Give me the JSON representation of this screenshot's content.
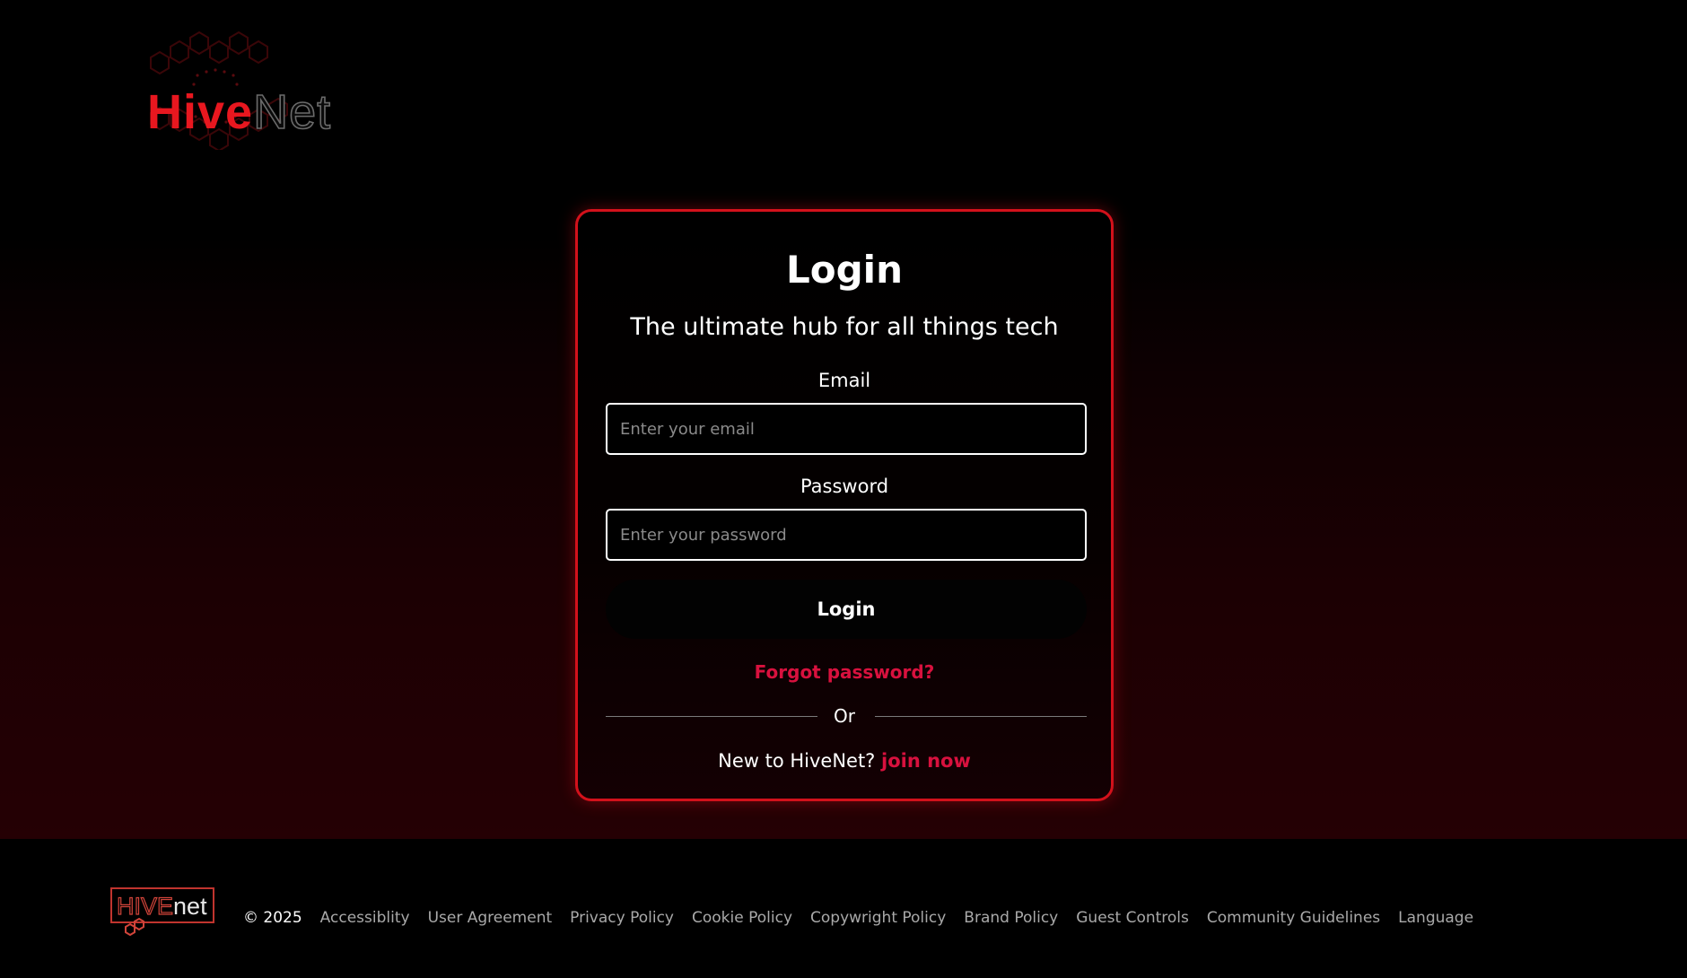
{
  "brand": {
    "logo_hive": "Hive",
    "logo_net": "Net",
    "footer_logo_hive": "HIVE",
    "footer_logo_net": "net",
    "colors": {
      "accent_red": "#e8171f",
      "link_red": "#d8113e",
      "card_border": "#d3111b"
    }
  },
  "login_card": {
    "title": "Login",
    "subtitle": "The ultimate hub for all things tech",
    "email_label": "Email",
    "email_placeholder": "Enter your email",
    "email_value": "",
    "password_label": "Password",
    "password_placeholder": "Enter your password",
    "password_value": "",
    "login_button": "Login",
    "forgot_password": "Forgot password?",
    "divider_text": "Or",
    "signup_prompt": "New to HiveNet?",
    "signup_link": "join now"
  },
  "footer": {
    "copyright": "© 2025",
    "links": [
      "Accessiblity",
      "User Agreement",
      "Privacy Policy",
      "Cookie Policy",
      "Copywright Policy",
      "Brand Policy",
      "Guest Controls",
      "Community Guidelines",
      "Language"
    ]
  }
}
